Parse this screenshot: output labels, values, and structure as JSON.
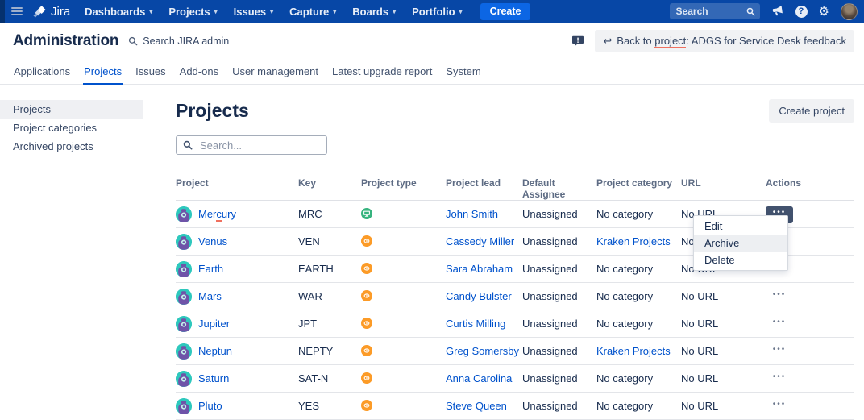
{
  "colors": {
    "navbar": "#0747A6",
    "accent_link": "#0052CC",
    "create_button": "#0C66E4",
    "software_green": "#36B37E",
    "business_orange": "#FC9B27",
    "misspell_red": "#F0705F"
  },
  "navbar": {
    "brand": "Jira",
    "menus": [
      {
        "label": "Dashboards"
      },
      {
        "label": "Projects"
      },
      {
        "label": "Issues"
      },
      {
        "label": "Capture"
      },
      {
        "label": "Boards"
      },
      {
        "label": "Portfolio"
      }
    ],
    "create": "Create",
    "search_placeholder": "Search",
    "help_glyph": "?",
    "gear_glyph": "⚙"
  },
  "admin": {
    "title": "Administration",
    "admin_search": "Search JIRA admin",
    "back": {
      "arrow": "↩",
      "prefix": "Back to ",
      "word": "project",
      "suffix": ": ADGS for Service Desk feedback"
    }
  },
  "tabs": [
    {
      "label": "Applications",
      "active": false
    },
    {
      "label": "Projects",
      "active": true
    },
    {
      "label": "Issues",
      "active": false
    },
    {
      "label": "Add-ons",
      "active": false
    },
    {
      "label": "User management",
      "active": false
    },
    {
      "label": "Latest upgrade report",
      "active": false
    },
    {
      "label": "System",
      "active": false
    }
  ],
  "sidebar": {
    "items": [
      {
        "label": "Projects",
        "active": true
      },
      {
        "label": "Project categories",
        "active": false
      },
      {
        "label": "Archived projects",
        "active": false
      }
    ]
  },
  "main": {
    "title": "Projects",
    "create_button": "Create project",
    "search_placeholder": "Search...",
    "table": {
      "headers": [
        "Project",
        "Key",
        "Project type",
        "Project lead",
        "Default Assignee",
        "Project category",
        "URL",
        "Actions"
      ],
      "actions_icon": "•••",
      "rows": [
        {
          "name_pre": "Mer",
          "name_mark": "c",
          "name_post": "ury",
          "key": "MRC",
          "is_software": true,
          "lead": "John Smith",
          "assignee": "Unassigned",
          "category": "No category",
          "category_is_link": false,
          "url": "No URL",
          "actions_active": true
        },
        {
          "name_pre": "Venus",
          "name_mark": "",
          "name_post": "",
          "key": "VEN",
          "is_software": false,
          "lead": "Cassedy Miller",
          "assignee": "Unassigned",
          "category": "Kraken Projects",
          "category_is_link": true,
          "url": "No URL",
          "actions_active": false
        },
        {
          "name_pre": "Earth",
          "name_mark": "",
          "name_post": "",
          "key": "EARTH",
          "is_software": false,
          "lead": "Sara Abraham",
          "assignee": "Unassigned",
          "category": "No category",
          "category_is_link": false,
          "url": "No URL",
          "actions_active": false
        },
        {
          "name_pre": "Mars",
          "name_mark": "",
          "name_post": "",
          "key": "WAR",
          "is_software": false,
          "lead": "Candy Bulster",
          "assignee": "Unassigned",
          "category": "No category",
          "category_is_link": false,
          "url": "No URL",
          "actions_active": false
        },
        {
          "name_pre": "Jupiter",
          "name_mark": "",
          "name_post": "",
          "key": "JPT",
          "is_software": false,
          "lead": "Curtis Milling",
          "assignee": "Unassigned",
          "category": "No category",
          "category_is_link": false,
          "url": "No URL",
          "actions_active": false
        },
        {
          "name_pre": "Neptun",
          "name_mark": "",
          "name_post": "",
          "key": "NEPTY",
          "is_software": false,
          "lead": "Greg Somersby",
          "assignee": "Unassigned",
          "category": "Kraken Projects",
          "category_is_link": true,
          "url": "No URL",
          "actions_active": false
        },
        {
          "name_pre": "Saturn",
          "name_mark": "",
          "name_post": "",
          "key": "SAT-N",
          "is_software": false,
          "lead": "Anna Carolina",
          "assignee": "Unassigned",
          "category": "No category",
          "category_is_link": false,
          "url": "No URL",
          "actions_active": false
        },
        {
          "name_pre": "Pluto",
          "name_mark": "",
          "name_post": "",
          "key": "YES",
          "is_software": false,
          "lead": "Steve Queen",
          "assignee": "Unassigned",
          "category": "No category",
          "category_is_link": false,
          "url": "No URL",
          "actions_active": false
        }
      ]
    },
    "actions_menu": {
      "items": [
        {
          "label": "Edit",
          "highlighted": false
        },
        {
          "label": "Archive",
          "highlighted": true
        },
        {
          "label": "Delete",
          "highlighted": false
        }
      ]
    }
  }
}
